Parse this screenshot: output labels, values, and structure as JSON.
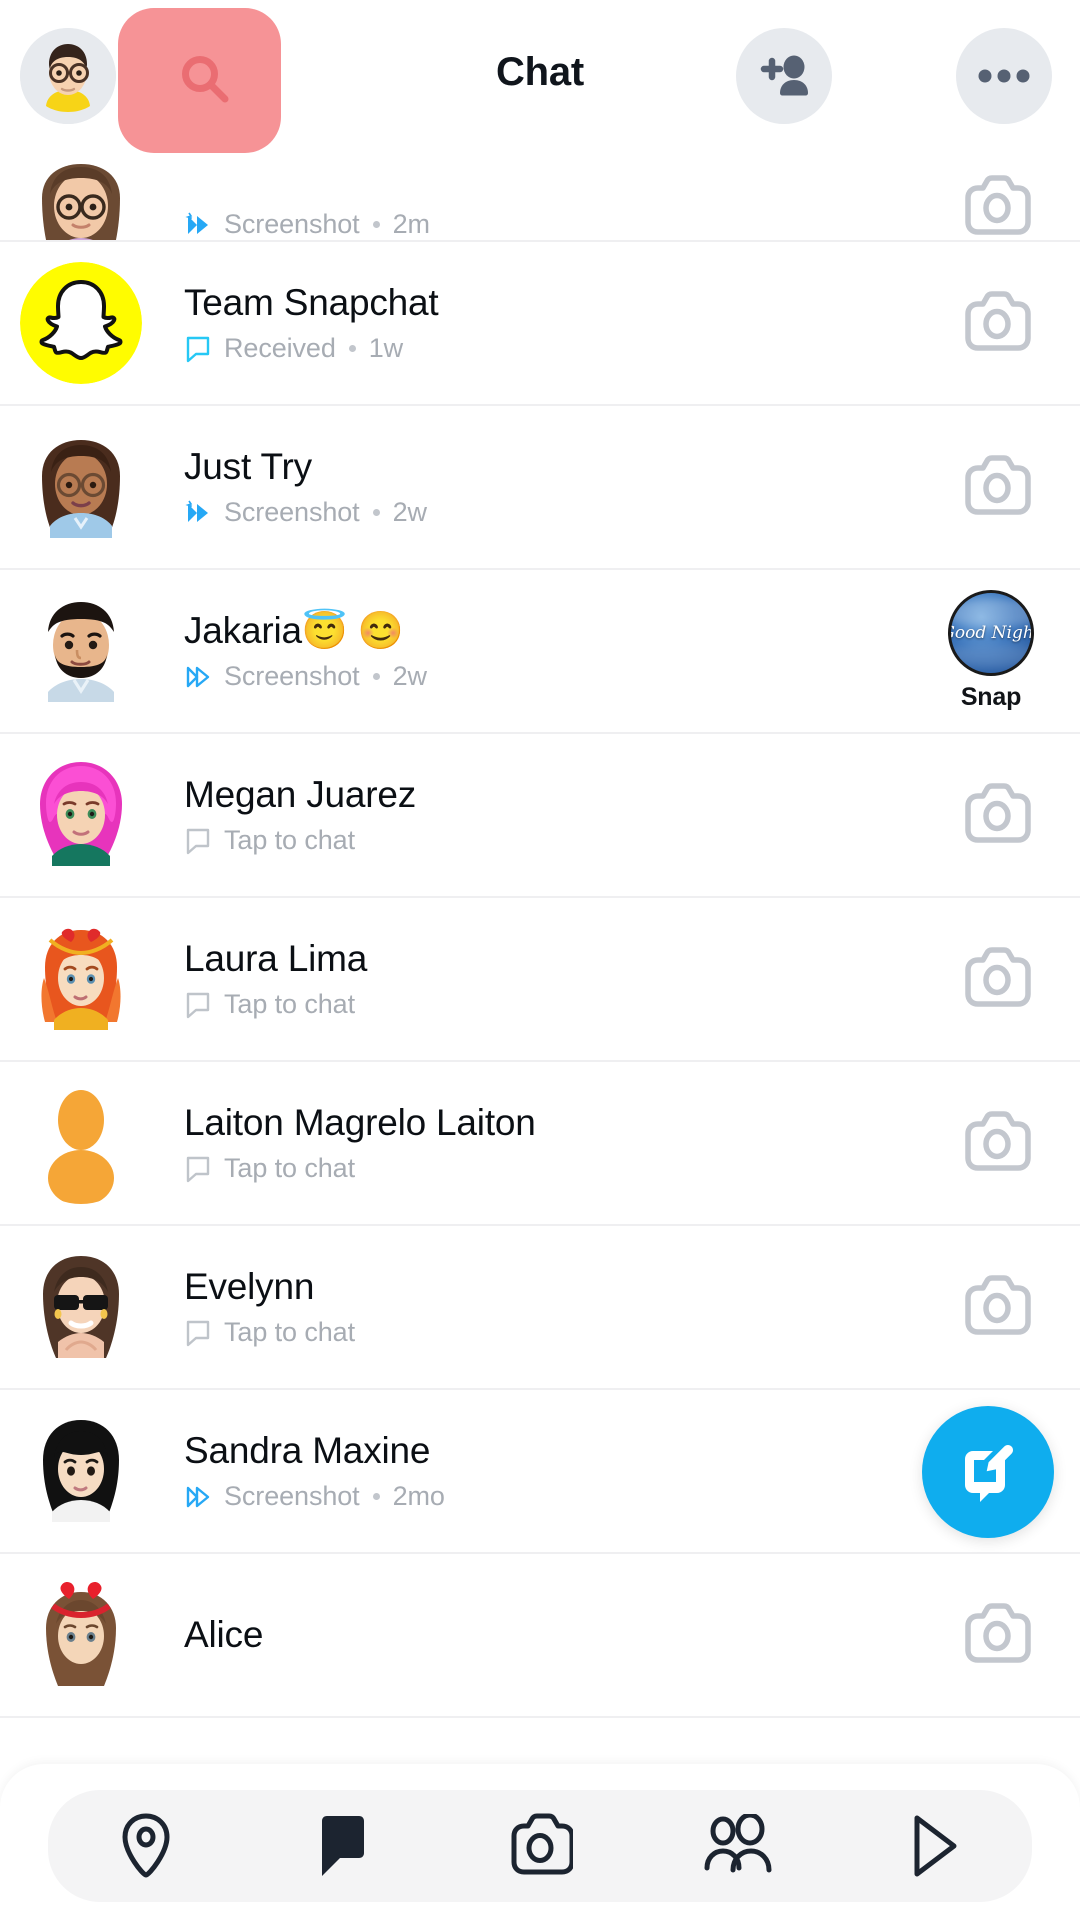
{
  "app": {
    "screen_title": "Chat",
    "accent_blue": "#0FADEE",
    "highlight_color": "#F4787C",
    "snapchat_yellow": "#FFFC00"
  },
  "header": {
    "title": "Chat",
    "profile_avatar_name": "bitmoji-avatar",
    "search_icon": "search-icon",
    "add_friend_icon": "add-friend-icon",
    "more_options_icon": "more-options-icon"
  },
  "chats": [
    {
      "name": "",
      "status": "Screenshot",
      "status_icon": "screenshot-icon",
      "time": "2m",
      "avatar": "bitmoji-glasses-brown",
      "right": "camera-icon",
      "partial": true
    },
    {
      "name": "Team Snapchat",
      "status": "Received",
      "status_icon": "chat-received-icon",
      "time": "1w",
      "avatar": "snapchat-ghost",
      "right": "camera-icon",
      "partial": false
    },
    {
      "name": "Just Try",
      "status": "Screenshot",
      "status_icon": "screenshot-icon",
      "time": "2w",
      "avatar": "bitmoji-glasses-blue-hoodie",
      "right": "camera-icon",
      "partial": false
    },
    {
      "name": "Jakaria😇 😊",
      "status": "Screenshot",
      "status_icon": "screenshot-opened-icon",
      "time": "2w",
      "avatar": "bitmoji-man-beard",
      "right": "snap-thumbnail",
      "snap_thumb_text": "Good Night",
      "snap_label": "Snap",
      "partial": false
    },
    {
      "name": "Megan Juarez",
      "status": "Tap to chat",
      "status_icon": "chat-icon",
      "time": "",
      "avatar": "bitmoji-pink-hair",
      "right": "camera-icon",
      "partial": false
    },
    {
      "name": "Laura Lima",
      "status": "Tap to chat",
      "status_icon": "chat-icon",
      "time": "",
      "avatar": "bitmoji-orange-hair",
      "right": "camera-icon",
      "partial": false
    },
    {
      "name": "Laiton Magrelo Laiton",
      "status": "Tap to chat",
      "status_icon": "chat-icon",
      "time": "",
      "avatar": "default-silhouette-orange",
      "right": "camera-icon",
      "partial": false
    },
    {
      "name": "Evelynn",
      "status": "Tap to chat",
      "status_icon": "chat-icon",
      "time": "",
      "avatar": "bitmoji-sunglasses",
      "right": "camera-icon",
      "partial": false
    },
    {
      "name": "Sandra Maxine",
      "status": "Screenshot",
      "status_icon": "screenshot-opened-icon",
      "time": "2mo",
      "avatar": "bitmoji-black-bob",
      "right": "camera-icon",
      "partial": false
    },
    {
      "name": "Alice",
      "status": "",
      "status_icon": "",
      "time": "",
      "avatar": "bitmoji-heart-headband",
      "right": "camera-icon",
      "partial": false
    }
  ],
  "fab": {
    "icon": "new-chat-icon",
    "label": "New Chat"
  },
  "bottom_nav": [
    {
      "icon": "map-pin-icon",
      "label": "Map",
      "active": false
    },
    {
      "icon": "chat-bubble-icon",
      "label": "Chat",
      "active": true
    },
    {
      "icon": "camera-icon",
      "label": "Camera",
      "active": false
    },
    {
      "icon": "friends-icon",
      "label": "Stories",
      "active": false
    },
    {
      "icon": "play-icon",
      "label": "Spotlight",
      "active": false
    }
  ]
}
